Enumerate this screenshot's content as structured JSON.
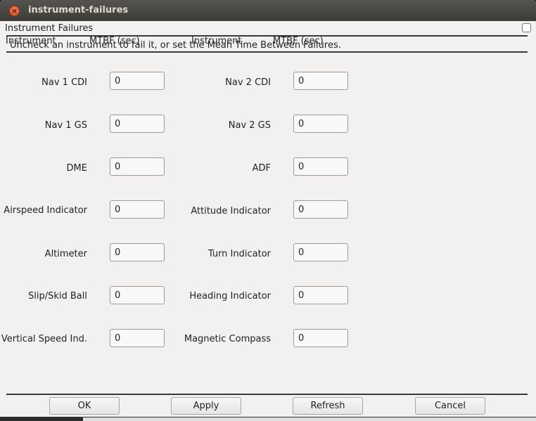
{
  "window": {
    "title": "instrument-failures"
  },
  "dialog": {
    "heading": "Instrument Failures",
    "instructions": "Uncheck an instrument to fail it, or set the Mean Time Between Failures.",
    "col_headers": [
      "Instrument",
      "MTBF (sec)",
      "Instrument",
      "MTBF (sec)"
    ]
  },
  "left_fields": [
    {
      "label": "Nav 1 CDI",
      "value": "0"
    },
    {
      "label": "Nav 1 GS",
      "value": "0"
    },
    {
      "label": "DME",
      "value": "0"
    },
    {
      "label": "Airspeed Indicator",
      "value": "0"
    },
    {
      "label": "Altimeter",
      "value": "0"
    },
    {
      "label": "Slip/Skid Ball",
      "value": "0"
    },
    {
      "label": "Vertical Speed Ind.",
      "value": "0"
    }
  ],
  "right_fields": [
    {
      "label": "Nav 2 CDI",
      "value": "0"
    },
    {
      "label": "Nav 2 GS",
      "value": "0"
    },
    {
      "label": "ADF",
      "value": "0"
    },
    {
      "label": "Attitude Indicator",
      "value": "0"
    },
    {
      "label": "Turn Indicator",
      "value": "0"
    },
    {
      "label": "Heading Indicator",
      "value": "0"
    },
    {
      "label": "Magnetic Compass",
      "value": "0"
    }
  ],
  "buttons": {
    "ok": "OK",
    "apply": "Apply",
    "refresh": "Refresh",
    "cancel": "Cancel"
  },
  "icons": {
    "close": "close-icon"
  }
}
